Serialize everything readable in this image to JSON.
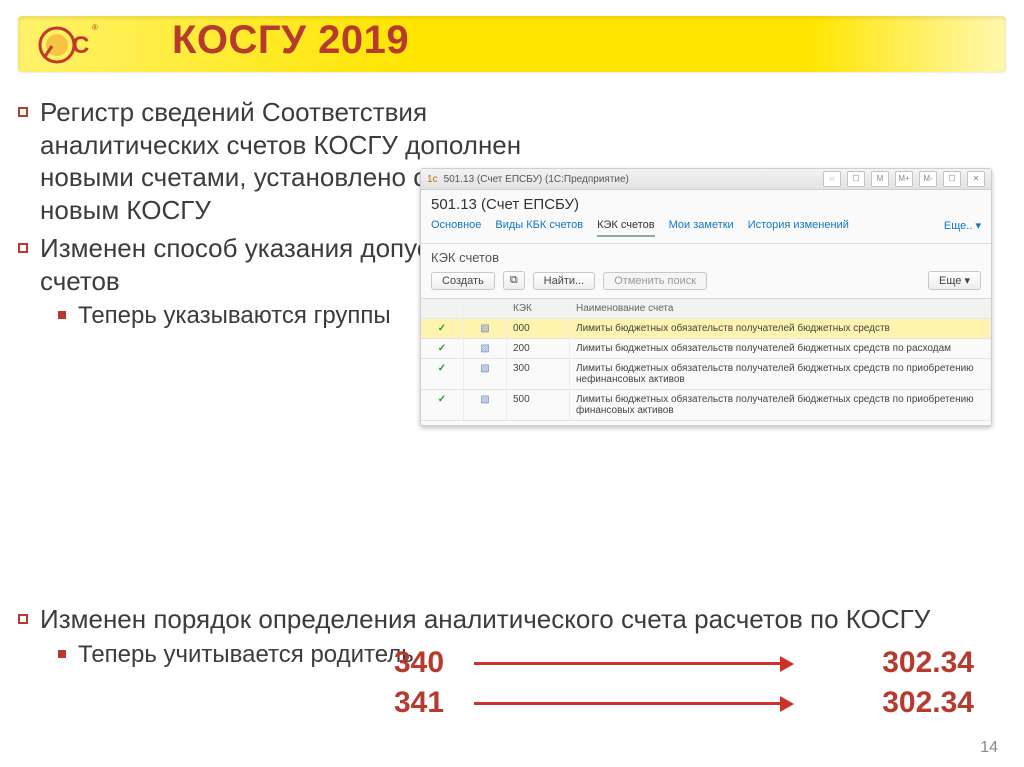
{
  "slide": {
    "title": "КОСГУ 2019",
    "page": "14"
  },
  "bullets": {
    "b1": "Регистр сведений Соответствия аналитических счетов КОСГУ дополнен новыми счетами, установлено соответствие новым КОСГУ",
    "b2": "Изменен способ указания допустимых КОСГУ счетов",
    "s2": "Теперь указываются группы",
    "b3": "Изменен порядок определения аналитического счета расчетов по КОСГУ",
    "s3": "Теперь учитывается родитель"
  },
  "shot": {
    "titlebar": "501.13 (Счет ЕПСБУ) (1С:Предприятие)",
    "main_title": "501.13 (Счет ЕПСБУ)",
    "tabs": {
      "t1": "Основное",
      "t2": "Виды КБК счетов",
      "t3": "КЭК счетов",
      "t4": "Мои заметки",
      "t5": "История изменений",
      "more": "Еще..  ▾"
    },
    "subtitle": "КЭК счетов",
    "toolbar": {
      "create": "Создать",
      "find": "Найти...",
      "cancel": "Отменить поиск",
      "more": "Еще  ▾"
    },
    "columns": {
      "c2": "КЭК",
      "c3": "Наименование счета"
    },
    "rows": [
      {
        "code": "000",
        "name": "Лимиты бюджетных обязательств получателей бюджетных средств"
      },
      {
        "code": "200",
        "name": "Лимиты бюджетных обязательств получателей бюджетных средств по расходам"
      },
      {
        "code": "300",
        "name": "Лимиты бюджетных обязательств получателей бюджетных средств по приобретению нефинансовых активов"
      },
      {
        "code": "500",
        "name": "Лимиты бюджетных обязательств получателей бюджетных средств по приобретению финансовых активов"
      }
    ]
  },
  "mapping": {
    "rows": [
      {
        "left": "340",
        "right": "302.34"
      },
      {
        "left": "341",
        "right": "302.34"
      }
    ]
  }
}
